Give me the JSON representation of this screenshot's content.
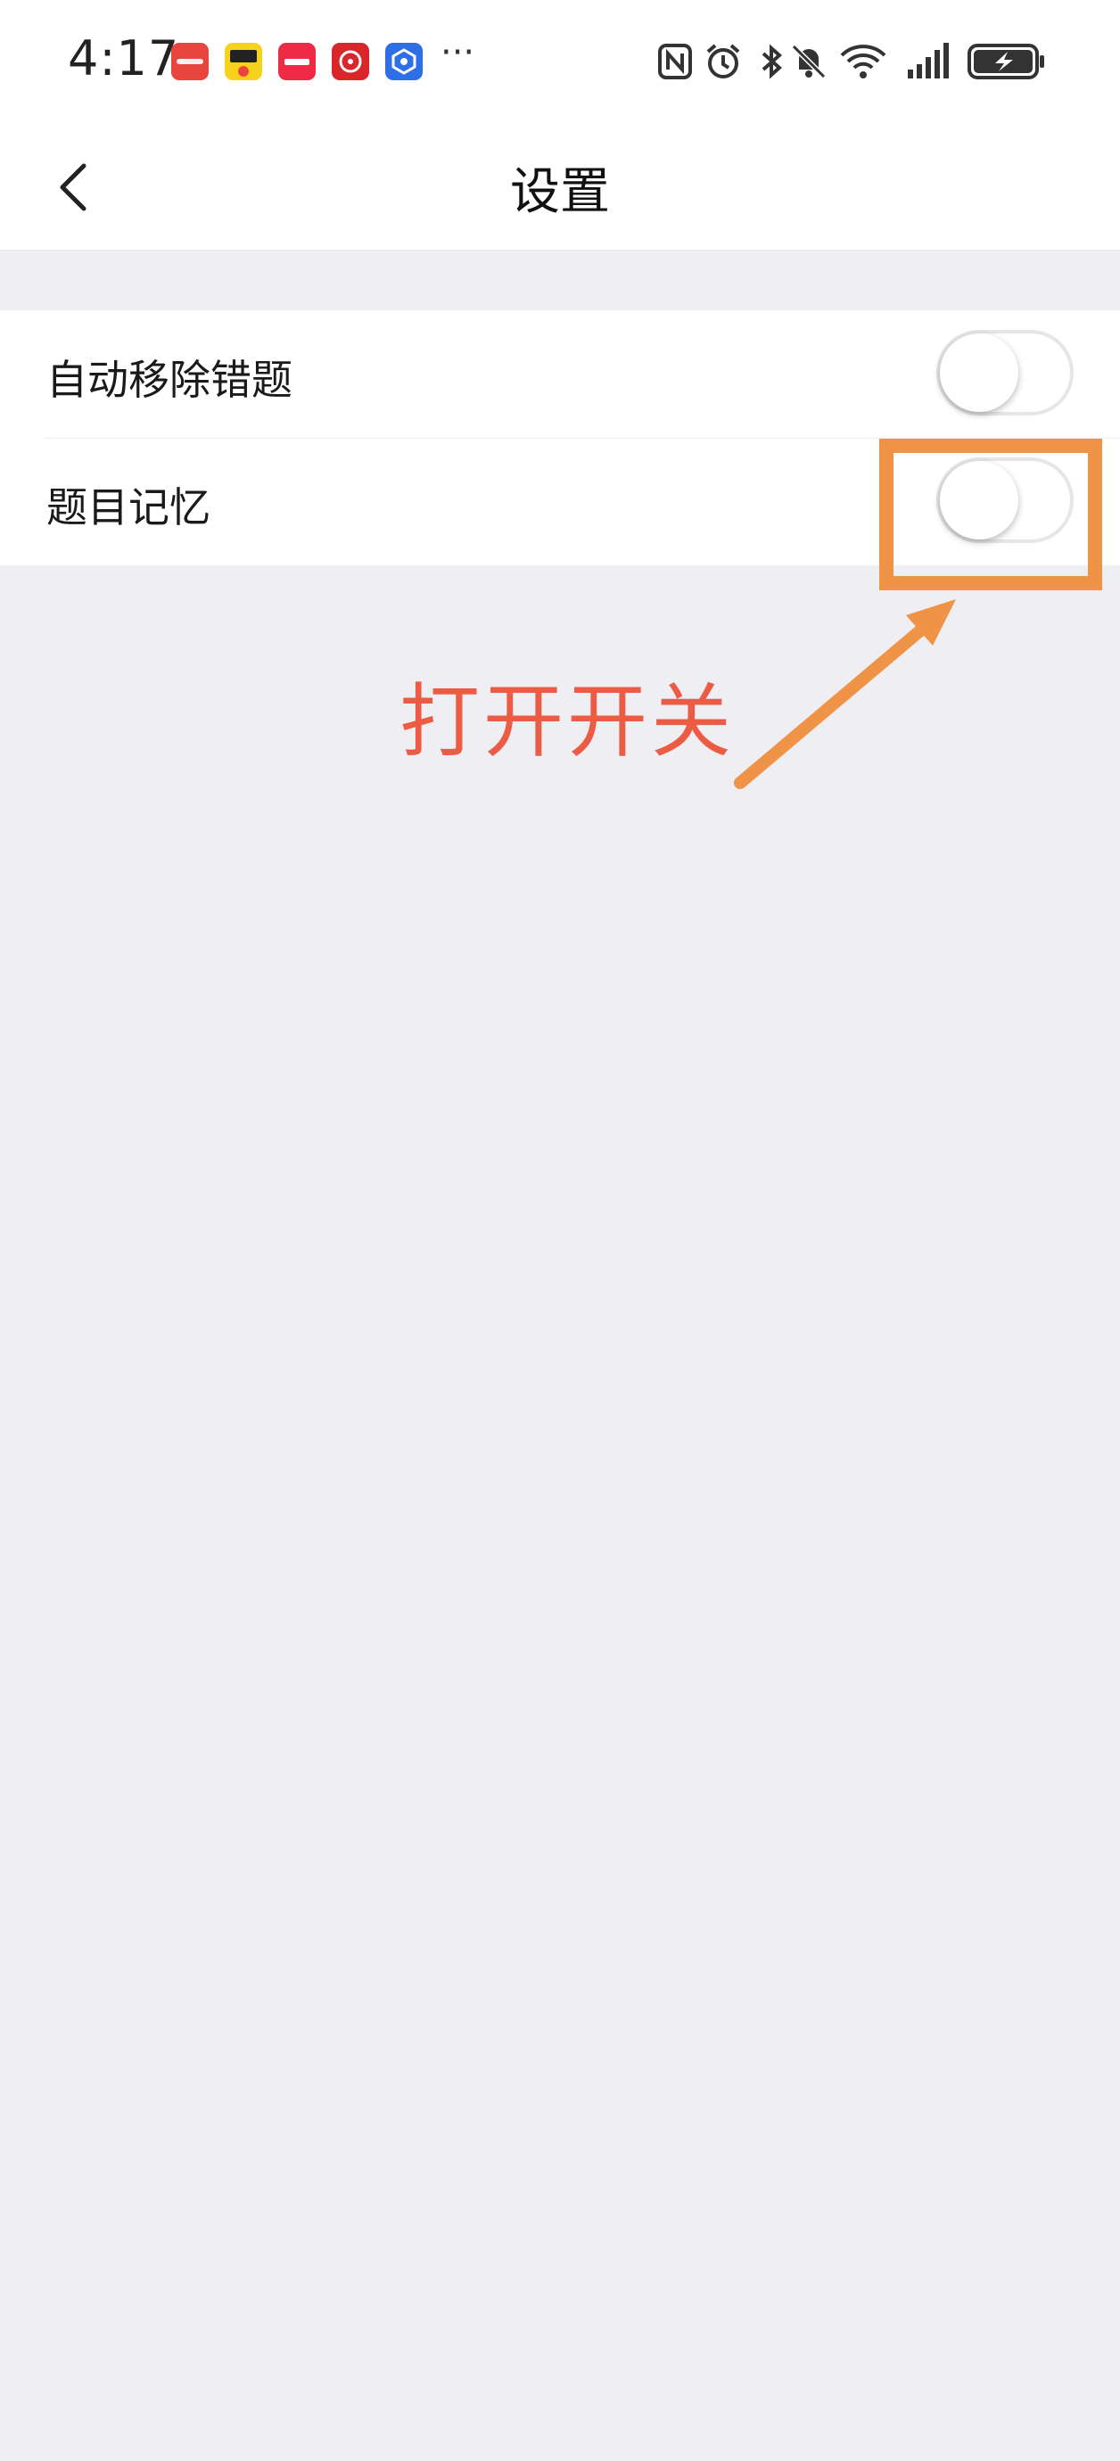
{
  "status_bar": {
    "time": "4:17",
    "notification_apps": [
      {
        "name": "huawei-appgallery-icon",
        "color": "#e9453f"
      },
      {
        "name": "yellow-app-icon",
        "color": "#f7d21b"
      },
      {
        "name": "xiaohongshu-icon",
        "color": "#ee2a44"
      },
      {
        "name": "red-flower-app-icon",
        "color": "#d8262b"
      },
      {
        "name": "blue-app-icon",
        "color": "#2f6fe6"
      }
    ],
    "more": "···"
  },
  "nav": {
    "title": "设置",
    "back_icon": "chevron-left-icon"
  },
  "settings": [
    {
      "label": "自动移除错题",
      "enabled": false
    },
    {
      "label": "题目记忆",
      "enabled": false
    }
  ],
  "annotation": {
    "text": "打开开关",
    "box_color": "#ef9347",
    "text_color": "#ec5c45"
  }
}
